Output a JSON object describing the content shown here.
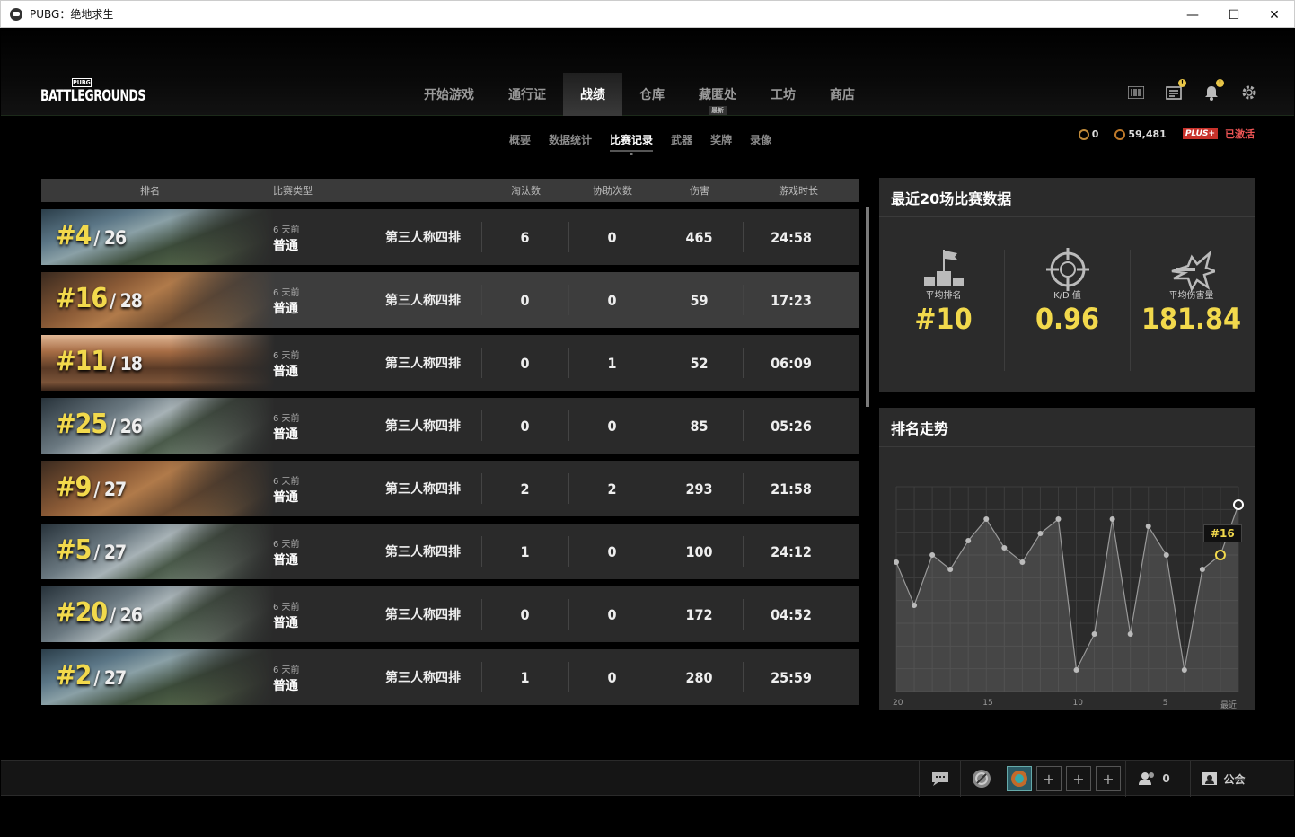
{
  "window": {
    "title": "PUBG：绝地求生",
    "minimize": "—",
    "maximize": "☐",
    "close": "✕"
  },
  "logo": {
    "small": "PUBG",
    "big": "BATTLEGROUNDS"
  },
  "nav": {
    "tabs": [
      {
        "label": "开始游戏"
      },
      {
        "label": "通行证"
      },
      {
        "label": "战绩",
        "active": true
      },
      {
        "label": "仓库"
      },
      {
        "label": "藏匿处",
        "badge": "最新"
      },
      {
        "label": "工坊"
      },
      {
        "label": "商店"
      }
    ],
    "sub_tabs": [
      {
        "label": "概要"
      },
      {
        "label": "数据统计"
      },
      {
        "label": "比赛记录",
        "active": true
      },
      {
        "label": "武器"
      },
      {
        "label": "奖牌"
      },
      {
        "label": "录像"
      }
    ],
    "icons": [
      "barcode-icon",
      "news-icon",
      "bell-icon",
      "gear-icon"
    ],
    "alert": "!"
  },
  "currency": {
    "coin_value": "0",
    "bp_value": "59,481",
    "plus_label": "PLUS+",
    "status": "已激活"
  },
  "table": {
    "headers": {
      "rank": "排名",
      "type": "比赛类型",
      "kills": "淘汰数",
      "assists": "协助次数",
      "damage": "伤害",
      "duration": "游戏时长"
    },
    "rows": [
      {
        "rank": "#4",
        "total": "/ 26",
        "when": "6 天前",
        "kind": "普通",
        "mode": "第三人称四排",
        "kills": "6",
        "assists": "0",
        "damage": "465",
        "duration": "24:58",
        "map": "mountain"
      },
      {
        "rank": "#16",
        "total": "/ 28",
        "when": "6 天前",
        "kind": "普通",
        "mode": "第三人称四排",
        "kills": "0",
        "assists": "0",
        "damage": "59",
        "duration": "17:23",
        "map": "desert"
      },
      {
        "rank": "#11",
        "total": "/ 18",
        "when": "6 天前",
        "kind": "普通",
        "mode": "第三人称四排",
        "kills": "0",
        "assists": "1",
        "damage": "52",
        "duration": "06:09",
        "map": "canyon"
      },
      {
        "rank": "#25",
        "total": "/ 26",
        "when": "6 天前",
        "kind": "普通",
        "mode": "第三人称四排",
        "kills": "0",
        "assists": "0",
        "damage": "85",
        "duration": "05:26",
        "map": "town"
      },
      {
        "rank": "#9",
        "total": "/ 27",
        "when": "6 天前",
        "kind": "普通",
        "mode": "第三人称四排",
        "kills": "2",
        "assists": "2",
        "damage": "293",
        "duration": "21:58",
        "map": "desert"
      },
      {
        "rank": "#5",
        "total": "/ 27",
        "when": "6 天前",
        "kind": "普通",
        "mode": "第三人称四排",
        "kills": "1",
        "assists": "0",
        "damage": "100",
        "duration": "24:12",
        "map": "town"
      },
      {
        "rank": "#20",
        "total": "/ 26",
        "when": "6 天前",
        "kind": "普通",
        "mode": "第三人称四排",
        "kills": "0",
        "assists": "0",
        "damage": "172",
        "duration": "04:52",
        "map": "town"
      },
      {
        "rank": "#2",
        "total": "/ 27",
        "when": "6 天前",
        "kind": "普通",
        "mode": "第三人称四排",
        "kills": "1",
        "assists": "0",
        "damage": "280",
        "duration": "25:59",
        "map": "mountain"
      }
    ]
  },
  "summary": {
    "title": "最近20场比赛数据",
    "stats": [
      {
        "label": "平均排名",
        "value": "#10",
        "icon": "podium-flag-icon"
      },
      {
        "label": "K/D 值",
        "value": "0.96",
        "icon": "crosshair-icon"
      },
      {
        "label": "平均伤害量",
        "value": "181.84",
        "icon": "bullet-impact-icon"
      }
    ]
  },
  "chart_data": {
    "type": "area",
    "title": "排名走势",
    "x_ticks": [
      "20",
      "15",
      "10",
      "5",
      "最近"
    ],
    "x": [
      20,
      19,
      18,
      17,
      16,
      15,
      14,
      13,
      12,
      11,
      10,
      9,
      8,
      7,
      6,
      5,
      4,
      3,
      2,
      1
    ],
    "values": [
      10,
      16,
      9,
      11,
      7,
      4,
      8,
      10,
      6,
      4,
      25,
      20,
      4,
      20,
      5,
      9,
      25,
      11,
      9,
      2
    ],
    "ylim": [
      1,
      28
    ],
    "inverted_y": true,
    "highlight": {
      "index": 18,
      "label": "#16"
    },
    "grid": true
  },
  "bottom": {
    "party_count": "0",
    "guild_label": "公会",
    "slot_plus": "+"
  },
  "colors": {
    "accent": "#f2d94c",
    "bg": "#000000",
    "panel": "#2b2b2b",
    "plus": "#c8322b"
  }
}
